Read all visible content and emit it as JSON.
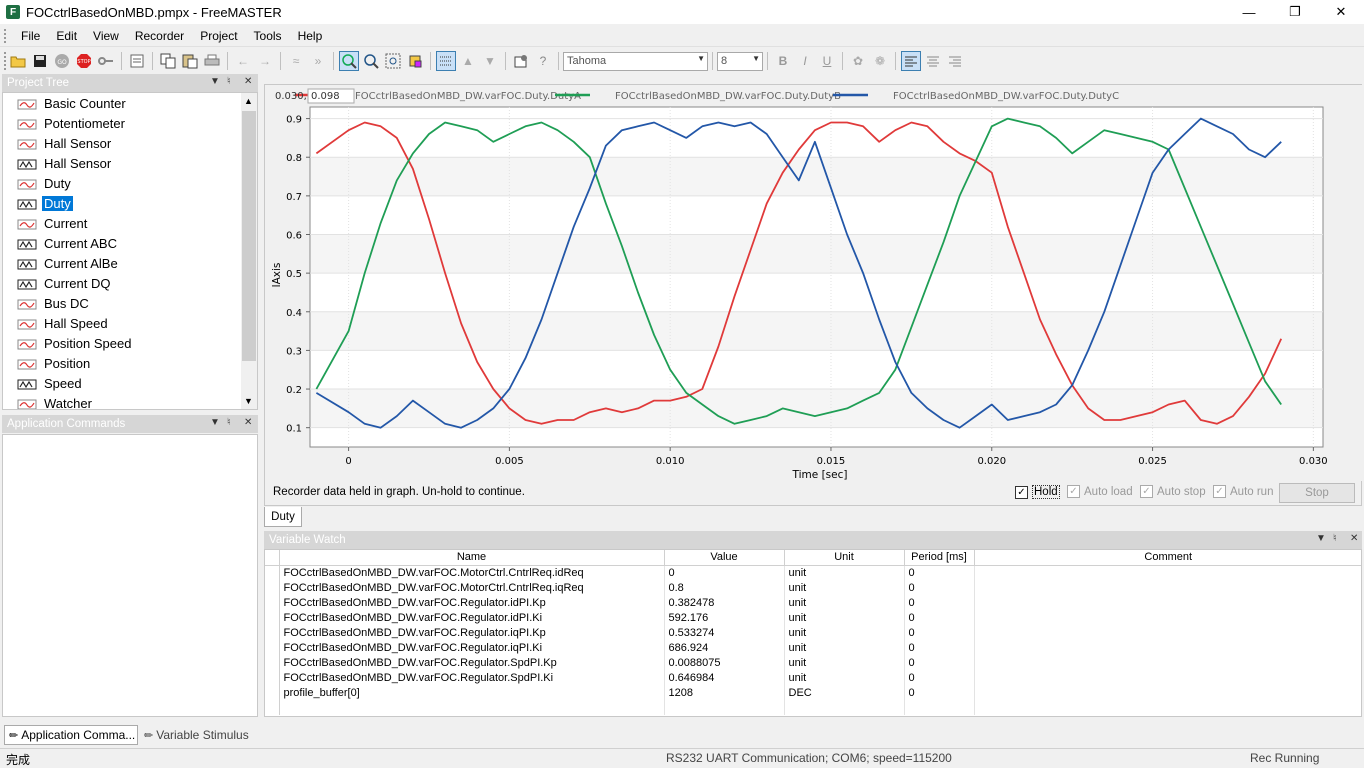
{
  "window": {
    "title": "FOCctrlBasedOnMBD.pmpx - FreeMASTER",
    "app_icon": "F",
    "minimize": "—",
    "maximize": "❐",
    "close": "✕"
  },
  "menu": [
    "File",
    "Edit",
    "View",
    "Recorder",
    "Project",
    "Tools",
    "Help"
  ],
  "toolbar": {
    "font_name": "Tahoma",
    "font_size": "8",
    "bold": "B",
    "italic": "I",
    "underline": "U"
  },
  "project_tree": {
    "title": "Project Tree",
    "items": [
      {
        "label": "Basic Counter",
        "kind": "scope"
      },
      {
        "label": "Potentiometer",
        "kind": "scope"
      },
      {
        "label": "Hall Sensor",
        "kind": "scope"
      },
      {
        "label": "Hall Sensor",
        "kind": "recorder"
      },
      {
        "label": "Duty",
        "kind": "scope"
      },
      {
        "label": "Duty",
        "kind": "recorder",
        "selected": true
      },
      {
        "label": "Current",
        "kind": "scope"
      },
      {
        "label": "Current ABC",
        "kind": "recorder"
      },
      {
        "label": "Current AlBe",
        "kind": "recorder"
      },
      {
        "label": "Current DQ",
        "kind": "recorder"
      },
      {
        "label": "Bus DC",
        "kind": "scope"
      },
      {
        "label": "Hall Speed",
        "kind": "scope"
      },
      {
        "label": "Position Speed",
        "kind": "scope"
      },
      {
        "label": "Position",
        "kind": "scope"
      },
      {
        "label": "Speed",
        "kind": "recorder"
      },
      {
        "label": "Watcher",
        "kind": "scope"
      }
    ]
  },
  "app_commands": {
    "title": "Application Commands"
  },
  "bottom_tabs": [
    "Application Comma...",
    "Variable Stimulus"
  ],
  "graph": {
    "readout_x": "0.030,",
    "readout_y": "0.098",
    "status_message": "Recorder data held in graph. Un-hold to continue.",
    "checkboxes": [
      {
        "label": "Hold",
        "checked": true,
        "enabled": true
      },
      {
        "label": "Auto load",
        "checked": true,
        "enabled": false
      },
      {
        "label": "Auto stop",
        "checked": true,
        "enabled": false
      },
      {
        "label": "Auto run",
        "checked": true,
        "enabled": false
      }
    ],
    "stop_label": "Stop",
    "tab_label": "Duty"
  },
  "chart_data": {
    "type": "line",
    "title": "",
    "xlabel": "Time [sec]",
    "ylabel": "lAxis",
    "xlim": [
      -0.0012,
      0.0303
    ],
    "ylim": [
      0.05,
      0.93
    ],
    "x_ticks": [
      0,
      0.005,
      0.01,
      0.015,
      0.02,
      0.025,
      0.03
    ],
    "x_tick_labels": [
      "0",
      "0.005",
      "0.010",
      "0.015",
      "0.020",
      "0.025",
      "0.030"
    ],
    "y_ticks": [
      0.1,
      0.2,
      0.3,
      0.4,
      0.5,
      0.6,
      0.7,
      0.8,
      0.9
    ],
    "y_tick_labels": [
      "0.1",
      "0.2",
      "0.3",
      "0.4",
      "0.5",
      "0.6",
      "0.7",
      "0.8",
      "0.9"
    ],
    "grid": true,
    "legend_position": "top",
    "series": [
      {
        "name": "FOCctrlBasedOnMBD_DW.varFOC.Duty.DutyA",
        "color": "#e03a3a",
        "x": [
          -0.001,
          0,
          0.0005,
          0.001,
          0.0015,
          0.002,
          0.0025,
          0.003,
          0.0035,
          0.004,
          0.0045,
          0.005,
          0.0055,
          0.006,
          0.0065,
          0.007,
          0.0075,
          0.008,
          0.0085,
          0.009,
          0.0095,
          0.01,
          0.0105,
          0.011,
          0.0115,
          0.012,
          0.0125,
          0.013,
          0.0135,
          0.014,
          0.0145,
          0.015,
          0.0155,
          0.016,
          0.0165,
          0.017,
          0.0175,
          0.018,
          0.0185,
          0.019,
          0.0195,
          0.02,
          0.0205,
          0.021,
          0.0215,
          0.022,
          0.0225,
          0.023,
          0.0235,
          0.024,
          0.0245,
          0.025,
          0.0255,
          0.026,
          0.0265,
          0.027,
          0.0275,
          0.028,
          0.0285,
          0.029
        ],
        "y": [
          0.81,
          0.87,
          0.89,
          0.88,
          0.85,
          0.77,
          0.64,
          0.5,
          0.37,
          0.27,
          0.2,
          0.15,
          0.12,
          0.11,
          0.12,
          0.12,
          0.14,
          0.15,
          0.14,
          0.15,
          0.17,
          0.17,
          0.18,
          0.2,
          0.31,
          0.44,
          0.56,
          0.68,
          0.76,
          0.82,
          0.87,
          0.89,
          0.89,
          0.88,
          0.84,
          0.87,
          0.89,
          0.88,
          0.84,
          0.81,
          0.79,
          0.76,
          0.62,
          0.5,
          0.38,
          0.29,
          0.21,
          0.15,
          0.12,
          0.12,
          0.13,
          0.14,
          0.16,
          0.17,
          0.12,
          0.11,
          0.13,
          0.18,
          0.24,
          0.33
        ]
      },
      {
        "name": "FOCctrlBasedOnMBD_DW.varFOC.Duty.DutyB",
        "color": "#1f9e55",
        "x": [
          -0.001,
          0,
          0.0005,
          0.001,
          0.0015,
          0.002,
          0.0025,
          0.003,
          0.0035,
          0.004,
          0.0045,
          0.005,
          0.0055,
          0.006,
          0.0065,
          0.007,
          0.0075,
          0.008,
          0.0085,
          0.009,
          0.0095,
          0.01,
          0.0105,
          0.011,
          0.0115,
          0.012,
          0.0125,
          0.013,
          0.0135,
          0.014,
          0.0145,
          0.015,
          0.0155,
          0.016,
          0.0165,
          0.017,
          0.0175,
          0.018,
          0.0185,
          0.019,
          0.0195,
          0.02,
          0.0205,
          0.021,
          0.0215,
          0.022,
          0.0225,
          0.023,
          0.0235,
          0.024,
          0.0245,
          0.025,
          0.0255,
          0.026,
          0.0265,
          0.027,
          0.0275,
          0.028,
          0.0285,
          0.029
        ],
        "y": [
          0.2,
          0.35,
          0.5,
          0.63,
          0.74,
          0.81,
          0.86,
          0.89,
          0.88,
          0.87,
          0.84,
          0.86,
          0.88,
          0.89,
          0.87,
          0.84,
          0.8,
          0.68,
          0.57,
          0.45,
          0.34,
          0.25,
          0.19,
          0.16,
          0.13,
          0.11,
          0.12,
          0.13,
          0.15,
          0.14,
          0.13,
          0.14,
          0.15,
          0.17,
          0.19,
          0.25,
          0.36,
          0.47,
          0.58,
          0.7,
          0.79,
          0.88,
          0.9,
          0.89,
          0.88,
          0.85,
          0.81,
          0.84,
          0.87,
          0.86,
          0.85,
          0.84,
          0.82,
          0.72,
          0.62,
          0.52,
          0.42,
          0.32,
          0.22,
          0.16
        ]
      },
      {
        "name": "FOCctrlBasedOnMBD_DW.varFOC.Duty.DutyC",
        "color": "#2357a8",
        "x": [
          -0.001,
          0,
          0.0005,
          0.001,
          0.0015,
          0.002,
          0.0025,
          0.003,
          0.0035,
          0.004,
          0.0045,
          0.005,
          0.0055,
          0.006,
          0.0065,
          0.007,
          0.0075,
          0.008,
          0.0085,
          0.009,
          0.0095,
          0.01,
          0.0105,
          0.011,
          0.0115,
          0.012,
          0.0125,
          0.013,
          0.0135,
          0.014,
          0.0145,
          0.015,
          0.0155,
          0.016,
          0.0165,
          0.017,
          0.0175,
          0.018,
          0.0185,
          0.019,
          0.0195,
          0.02,
          0.0205,
          0.021,
          0.0215,
          0.022,
          0.0225,
          0.023,
          0.0235,
          0.024,
          0.0245,
          0.025,
          0.0255,
          0.026,
          0.0265,
          0.027,
          0.0275,
          0.028,
          0.0285,
          0.029
        ],
        "y": [
          0.19,
          0.14,
          0.11,
          0.1,
          0.13,
          0.17,
          0.14,
          0.11,
          0.1,
          0.12,
          0.15,
          0.2,
          0.28,
          0.38,
          0.5,
          0.62,
          0.72,
          0.83,
          0.87,
          0.88,
          0.89,
          0.87,
          0.85,
          0.88,
          0.89,
          0.88,
          0.89,
          0.86,
          0.8,
          0.74,
          0.84,
          0.72,
          0.6,
          0.5,
          0.38,
          0.27,
          0.19,
          0.15,
          0.12,
          0.1,
          0.13,
          0.16,
          0.12,
          0.13,
          0.14,
          0.16,
          0.21,
          0.3,
          0.4,
          0.52,
          0.64,
          0.76,
          0.82,
          0.86,
          0.9,
          0.88,
          0.86,
          0.82,
          0.8,
          0.84
        ]
      }
    ]
  },
  "variable_watch": {
    "title": "Variable Watch",
    "columns": [
      "Name",
      "Value",
      "Unit",
      "Period [ms]",
      "Comment"
    ],
    "rows": [
      {
        "name": "FOCctrlBasedOnMBD_DW.varFOC.MotorCtrl.CntrlReq.idReq",
        "value": "0",
        "unit": "unit",
        "period": "0",
        "comment": ""
      },
      {
        "name": "FOCctrlBasedOnMBD_DW.varFOC.MotorCtrl.CntrlReq.iqReq",
        "value": "0.8",
        "unit": "unit",
        "period": "0",
        "comment": ""
      },
      {
        "name": "FOCctrlBasedOnMBD_DW.varFOC.Regulator.idPI.Kp",
        "value": "0.382478",
        "unit": "unit",
        "period": "0",
        "comment": ""
      },
      {
        "name": "FOCctrlBasedOnMBD_DW.varFOC.Regulator.idPI.Ki",
        "value": "592.176",
        "unit": "unit",
        "period": "0",
        "comment": ""
      },
      {
        "name": "FOCctrlBasedOnMBD_DW.varFOC.Regulator.iqPI.Kp",
        "value": "0.533274",
        "unit": "unit",
        "period": "0",
        "comment": ""
      },
      {
        "name": "FOCctrlBasedOnMBD_DW.varFOC.Regulator.iqPI.Ki",
        "value": "686.924",
        "unit": "unit",
        "period": "0",
        "comment": ""
      },
      {
        "name": "FOCctrlBasedOnMBD_DW.varFOC.Regulator.SpdPI.Kp",
        "value": "0.0088075",
        "unit": "unit",
        "period": "0",
        "comment": ""
      },
      {
        "name": "FOCctrlBasedOnMBD_DW.varFOC.Regulator.SpdPI.Ki",
        "value": "0.646984",
        "unit": "unit",
        "period": "0",
        "comment": ""
      },
      {
        "name": "profile_buffer[0]",
        "value": "1208",
        "unit": "DEC",
        "period": "0",
        "comment": ""
      }
    ]
  },
  "statusbar": {
    "left": "完成",
    "center": "RS232 UART Communication; COM6; speed=115200",
    "right": "Rec Running"
  }
}
